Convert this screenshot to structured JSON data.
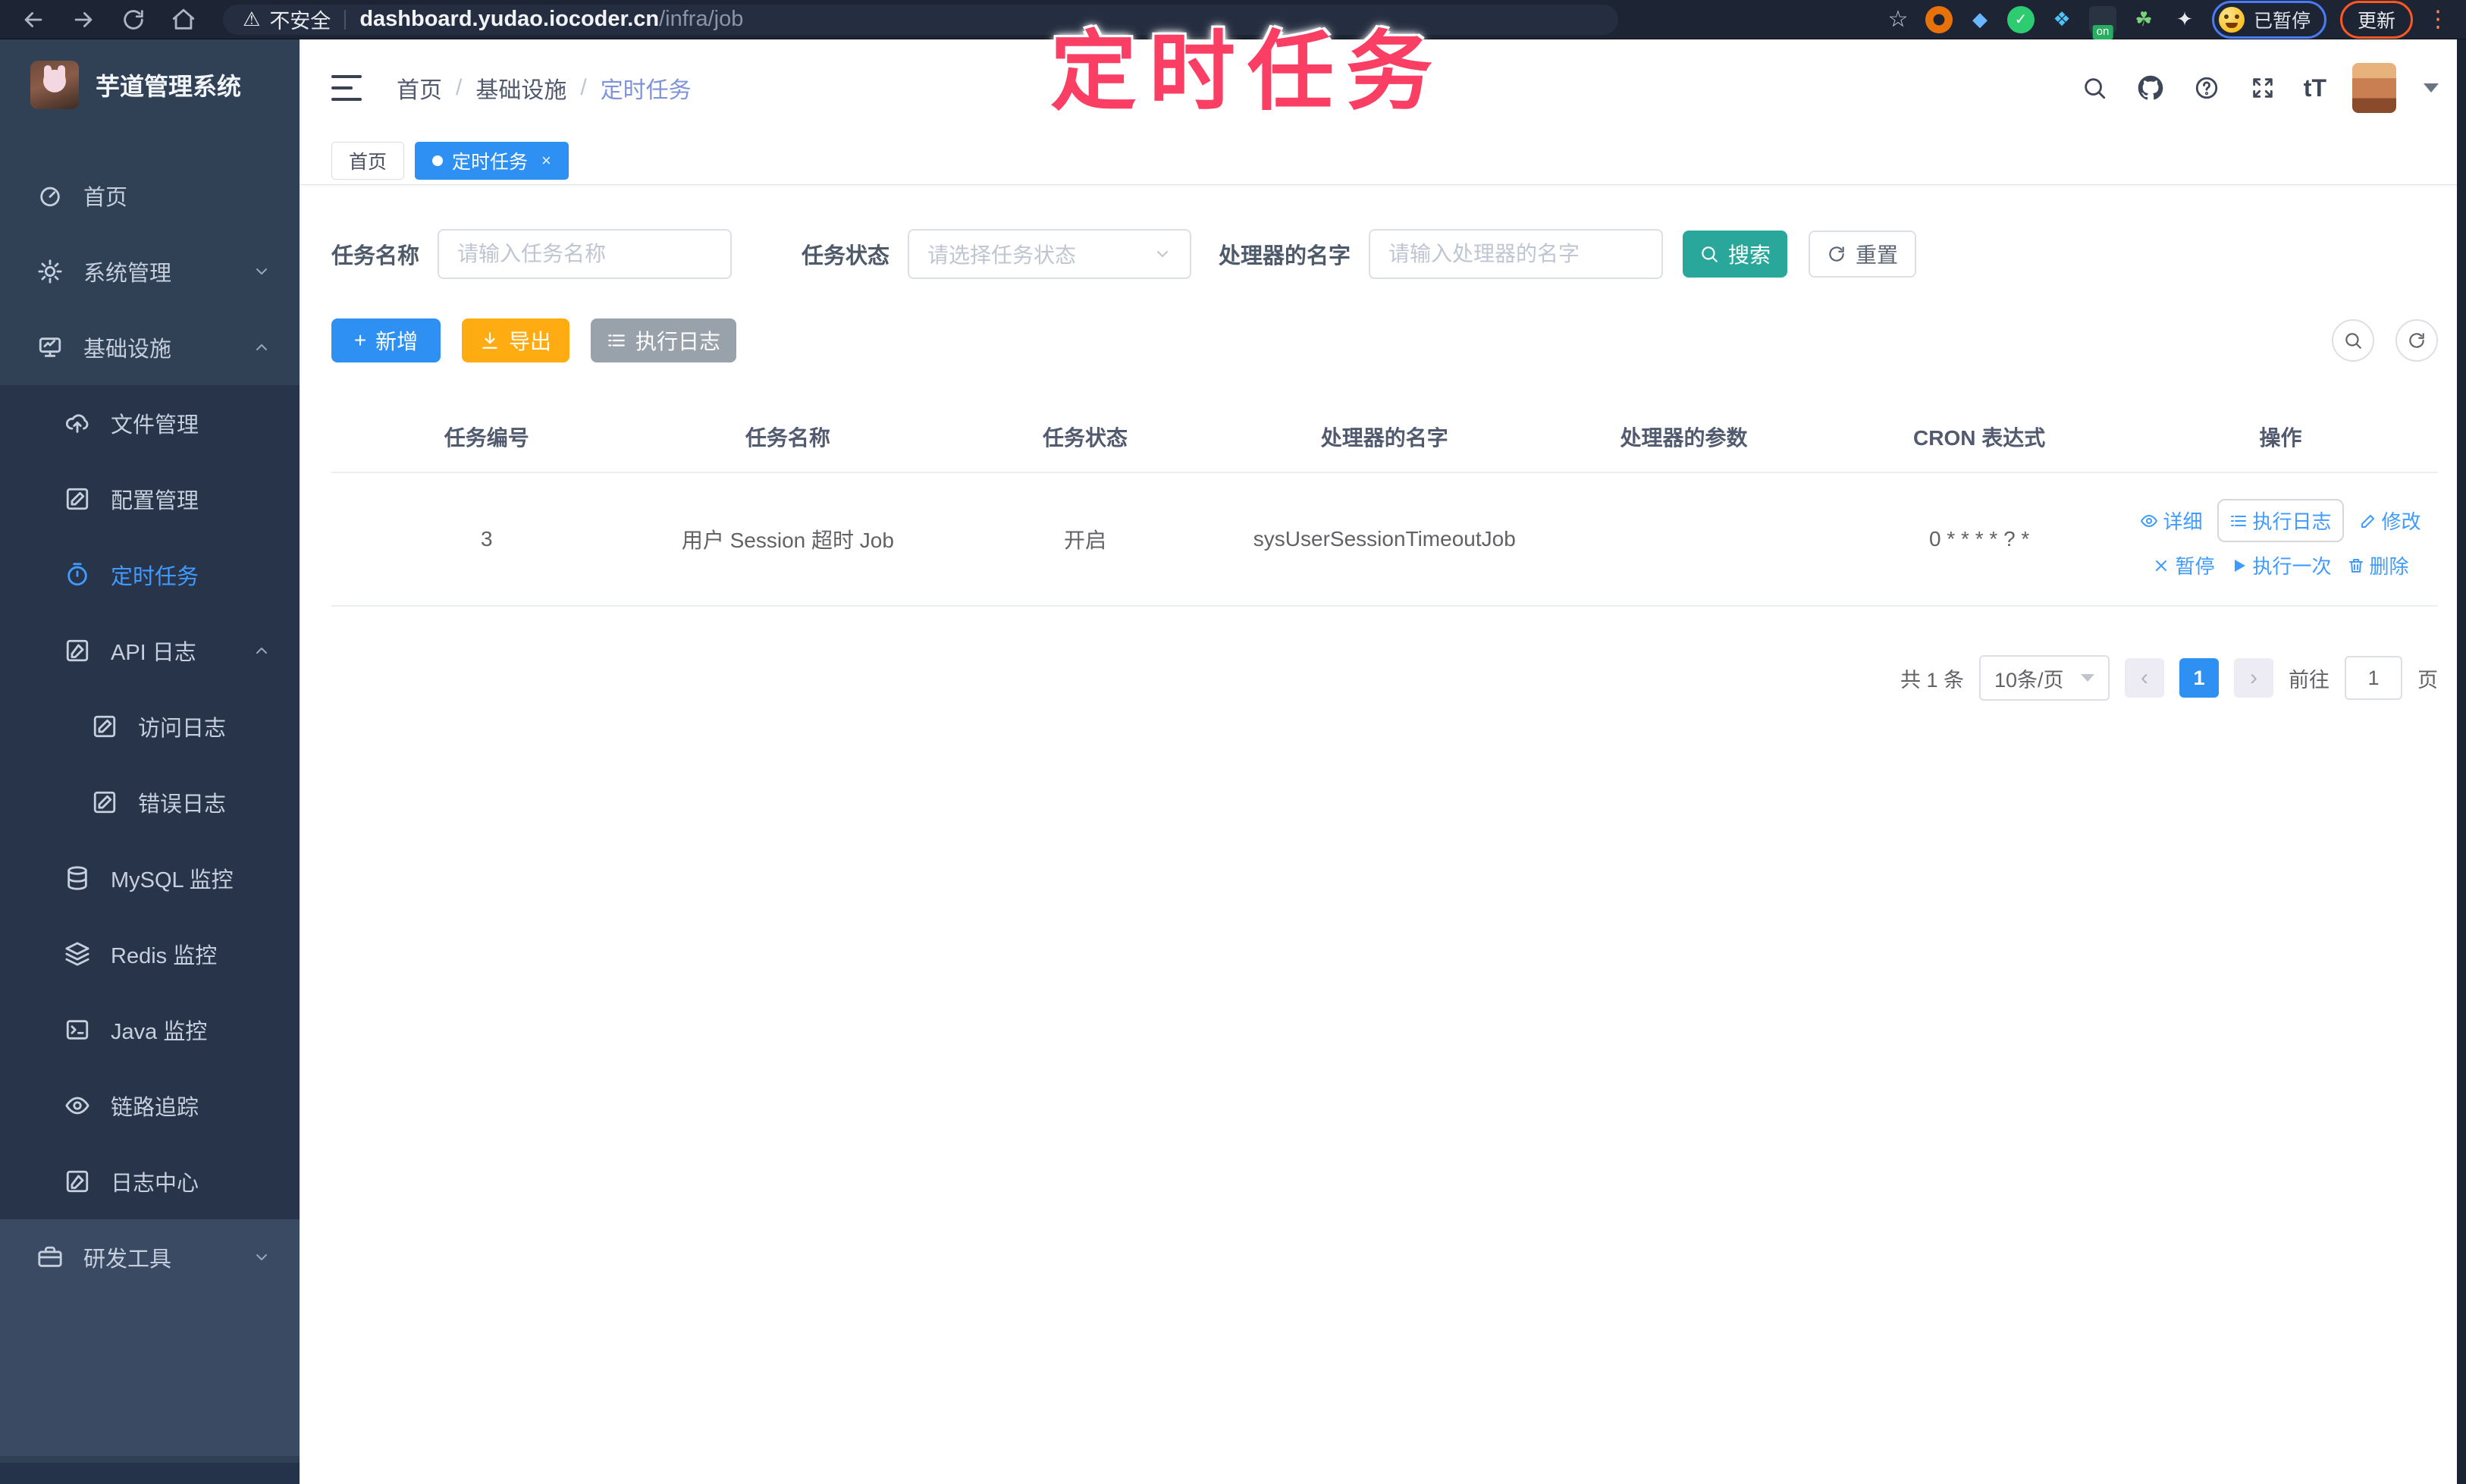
{
  "browser": {
    "security_label": "不安全",
    "url_host": "dashboard.yudao.iocoder.cn",
    "url_path": "/infra/job",
    "paused_label": "已暂停",
    "update_label": "更新"
  },
  "overlay_annotation": "定时任务",
  "sidebar": {
    "app_title": "芋道管理系统",
    "items": [
      {
        "label": "首页"
      },
      {
        "label": "系统管理"
      },
      {
        "label": "基础设施"
      },
      {
        "label": "文件管理"
      },
      {
        "label": "配置管理"
      },
      {
        "label": "定时任务"
      },
      {
        "label": "API 日志"
      },
      {
        "label": "访问日志"
      },
      {
        "label": "错误日志"
      },
      {
        "label": "MySQL 监控"
      },
      {
        "label": "Redis 监控"
      },
      {
        "label": "Java 监控"
      },
      {
        "label": "链路追踪"
      },
      {
        "label": "日志中心"
      },
      {
        "label": "研发工具"
      }
    ]
  },
  "header": {
    "breadcrumb": [
      "首页",
      "基础设施",
      "定时任务"
    ]
  },
  "tabs": [
    {
      "label": "首页"
    },
    {
      "label": "定时任务"
    }
  ],
  "filters": {
    "job_name_label": "任务名称",
    "job_name_placeholder": "请输入任务名称",
    "job_status_label": "任务状态",
    "job_status_placeholder": "请选择任务状态",
    "handler_label": "处理器的名字",
    "handler_placeholder": "请输入处理器的名字",
    "search_label": "搜索",
    "reset_label": "重置"
  },
  "toolbar": {
    "add_label": "新增",
    "export_label": "导出",
    "exec_log_label": "执行日志"
  },
  "table": {
    "headers": [
      "任务编号",
      "任务名称",
      "任务状态",
      "处理器的名字",
      "处理器的参数",
      "CRON 表达式",
      "操作"
    ],
    "rows": [
      {
        "id": "3",
        "name": "用户 Session 超时 Job",
        "status": "开启",
        "handler": "sysUserSessionTimeoutJob",
        "param": "",
        "cron": "0 * * * * ? *"
      }
    ],
    "ops": {
      "detail": "详细",
      "exec_log": "执行日志",
      "modify": "修改",
      "pause": "暂停",
      "run_once": "执行一次",
      "delete": "删除"
    }
  },
  "pagination": {
    "total_label": "共 1 条",
    "page_size": "10条/页",
    "current_page": "1",
    "goto_label": "前往",
    "goto_value": "1",
    "page_suffix": "页"
  },
  "colors": {
    "primary_blue": "#2e90f2",
    "link_blue": "#3f9bff",
    "search_teal": "#2aa79b",
    "export_amber": "#ffac12",
    "info_gray": "#99a1aa",
    "sidebar_bg": "#304156",
    "sidebar_submenu_bg": "#273449",
    "browser_bar_bg": "#1d2534",
    "annotation_pink": "#fb3e63"
  }
}
